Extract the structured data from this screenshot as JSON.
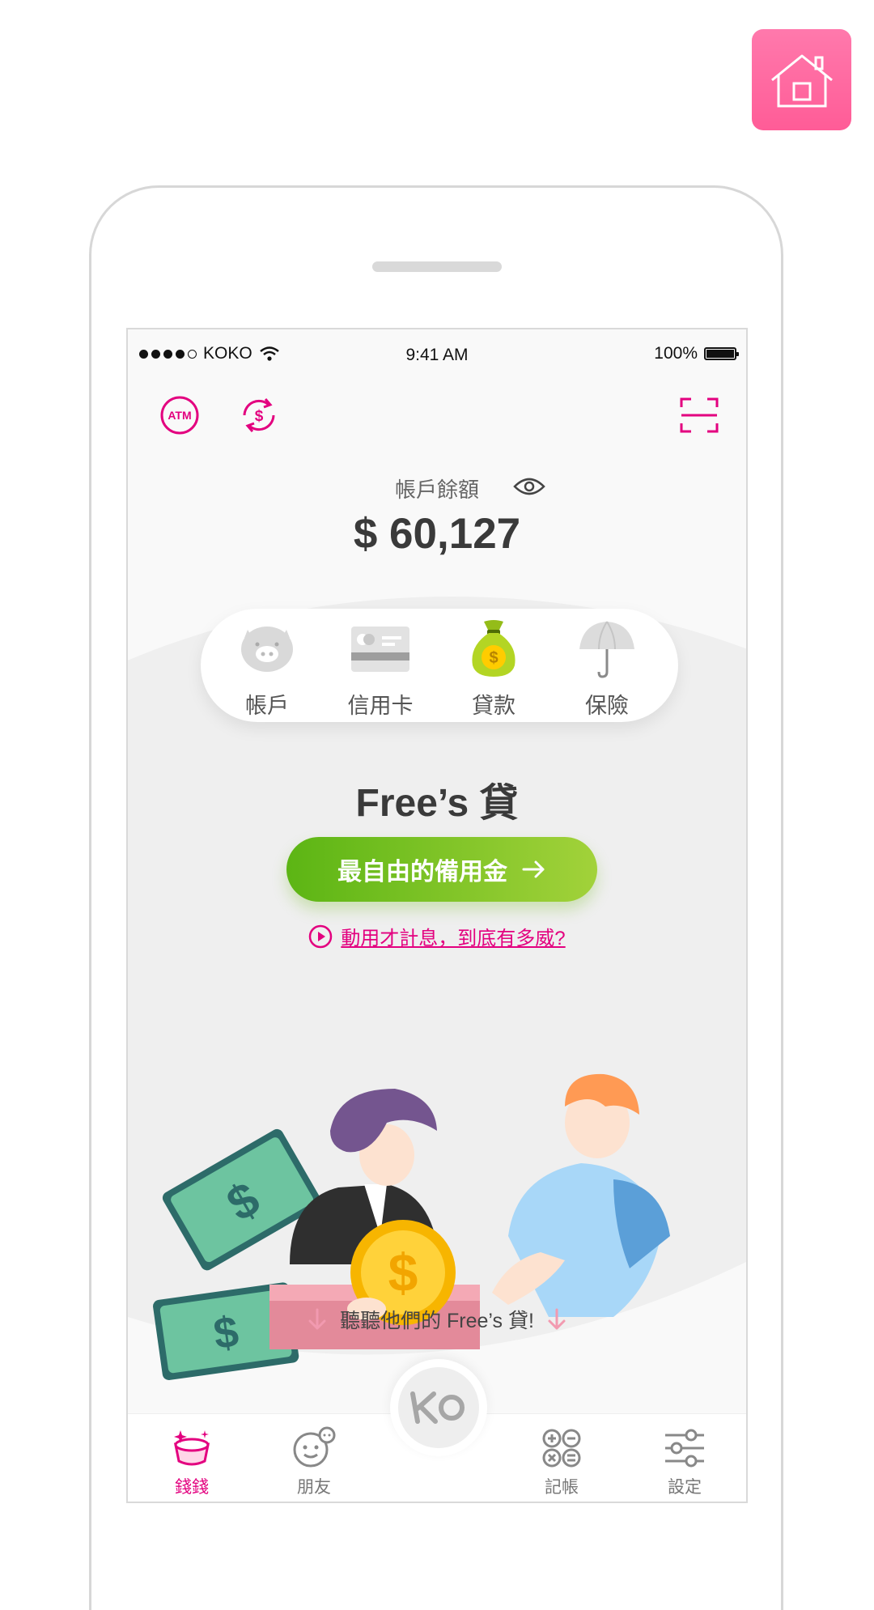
{
  "status_bar": {
    "carrier": "KOKO",
    "time": "9:41 AM",
    "battery": "100%"
  },
  "top_actions": {
    "atm_icon": "atm-icon",
    "exchange_icon": "currency-exchange-icon",
    "scan_icon": "scan-icon"
  },
  "balance": {
    "label": "帳戶餘額",
    "value": "$ 60,127"
  },
  "categories": [
    {
      "label": "帳戶",
      "icon": "piggy-bank-icon"
    },
    {
      "label": "信用卡",
      "icon": "credit-card-icon"
    },
    {
      "label": "貸款",
      "icon": "money-bag-icon"
    },
    {
      "label": "保險",
      "icon": "umbrella-icon"
    }
  ],
  "product": {
    "title": "Free’s 貸",
    "cta_label": "最自由的備用金",
    "info_link": "動用才計息，到底有多威?",
    "listen_text": "聽聽他們的 Free’s 貸!"
  },
  "tabs": [
    {
      "label": "錢錢",
      "icon": "gold-ingot-icon",
      "active": true
    },
    {
      "label": "朋友",
      "icon": "friends-icon",
      "active": false
    },
    {
      "label": "記帳",
      "icon": "calculator-icon",
      "active": false
    },
    {
      "label": "設定",
      "icon": "settings-sliders-icon",
      "active": false
    }
  ],
  "center_logo": "KO",
  "colors": {
    "brand_pink": "#e3007f",
    "home_button": "#ff6ba2",
    "cta_green_start": "#5cb514",
    "cta_green_end": "#a2d23a"
  }
}
